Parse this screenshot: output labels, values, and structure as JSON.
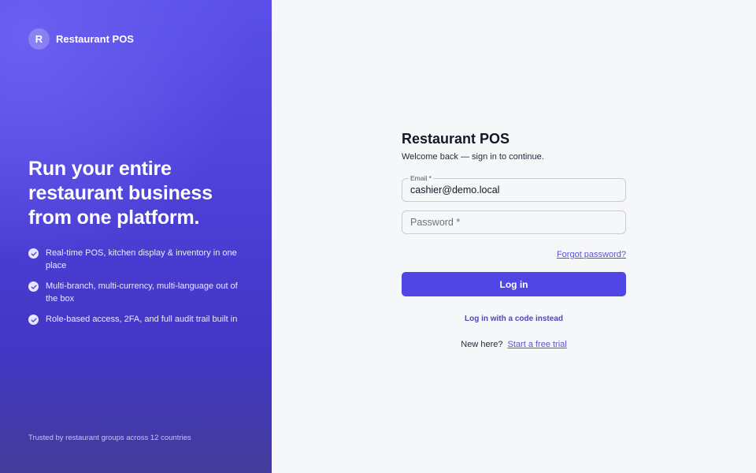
{
  "brand": {
    "logo_letter": "R",
    "app_name": "Restaurant POS",
    "headline": "Run your entire restaurant business from one platform.",
    "features": [
      "Real-time POS, kitchen display & inventory in one place",
      "Multi-branch, multi-currency, multi-language out of the box",
      "Role-based access, 2FA, and full audit trail built in"
    ],
    "trusted_text": "Trusted by restaurant groups across 12 countries",
    "colors": {
      "panel": "#4f46e5",
      "accent": "#4f46e5"
    }
  },
  "form": {
    "title": "Restaurant POS",
    "subtitle": "Welcome back — sign in to continue.",
    "email_label": "Email *",
    "email_value": "cashier@demo.local",
    "password_placeholder": "Password *",
    "forgot_label": "Forgot password?",
    "login_label": "Log in",
    "code_login_label": "Log in with a code instead",
    "signup_prompt": "New here?",
    "signup_link": "Start a free trial"
  },
  "icons": {
    "feature_bullet": "check-circle-icon"
  }
}
